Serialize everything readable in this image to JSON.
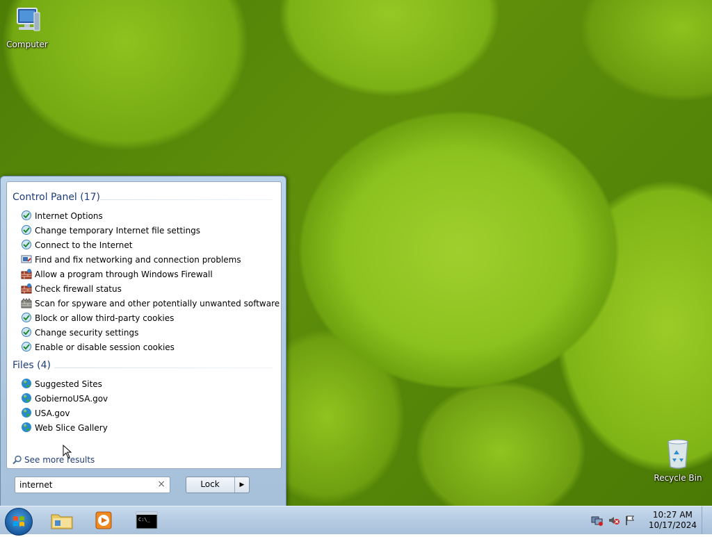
{
  "desktop": {
    "icons": [
      {
        "label": "Computer",
        "icon": "computer-icon"
      },
      {
        "label": "Recycle Bin",
        "icon": "recycle-bin-icon"
      }
    ]
  },
  "start_menu": {
    "control_panel": {
      "header": "Control Panel (17)",
      "items": [
        {
          "label": "Internet Options",
          "icon": "internet-options-icon"
        },
        {
          "label": "Change temporary Internet file settings",
          "icon": "internet-options-icon"
        },
        {
          "label": "Connect to the Internet",
          "icon": "internet-options-icon"
        },
        {
          "label": "Find and fix networking and connection problems",
          "icon": "troubleshoot-icon"
        },
        {
          "label": "Allow a program through Windows Firewall",
          "icon": "firewall-icon"
        },
        {
          "label": "Check firewall status",
          "icon": "firewall-icon"
        },
        {
          "label": "Scan for spyware and other potentially unwanted software",
          "icon": "defender-icon"
        },
        {
          "label": "Block or allow third-party cookies",
          "icon": "internet-options-icon"
        },
        {
          "label": "Change security settings",
          "icon": "internet-options-icon"
        },
        {
          "label": "Enable or disable session cookies",
          "icon": "internet-options-icon"
        }
      ]
    },
    "files": {
      "header": "Files (4)",
      "items": [
        {
          "label": "Suggested Sites",
          "icon": "globe-icon"
        },
        {
          "label": "GobiernoUSA.gov",
          "icon": "globe-icon"
        },
        {
          "label": "USA.gov",
          "icon": "globe-icon"
        },
        {
          "label": "Web Slice Gallery",
          "icon": "globe-icon"
        }
      ]
    },
    "see_more": "See more results",
    "search": {
      "value": "internet",
      "clear": "×"
    },
    "power_button": {
      "label": "Lock",
      "arrow": "▶"
    }
  },
  "taskbar": {
    "pinned": [
      {
        "name": "windows-explorer",
        "icon": "folder-icon"
      },
      {
        "name": "media-player",
        "icon": "media-player-icon"
      },
      {
        "name": "command-prompt",
        "icon": "cmd-icon"
      }
    ],
    "clock": {
      "time": "10:27 AM",
      "date": "10/17/2024"
    }
  },
  "colors": {
    "section_header": "#1e3c78",
    "taskbar": "#b5cbe2",
    "desktop_green": "#8cc21f"
  }
}
